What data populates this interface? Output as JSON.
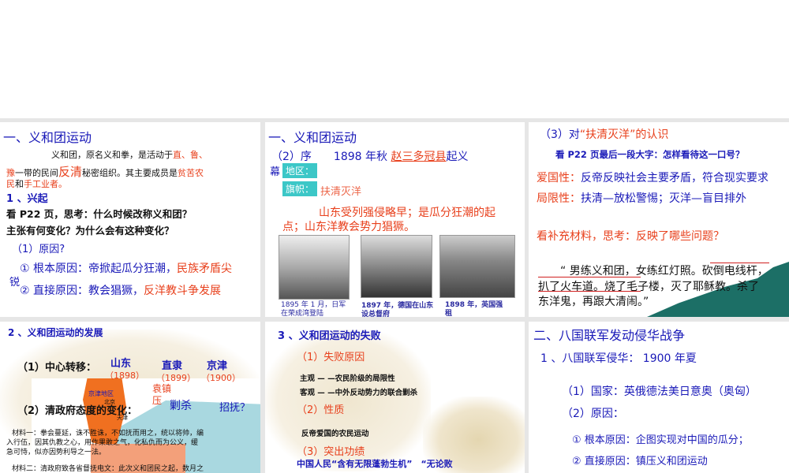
{
  "slides": [
    {
      "title": "一、义和团运动",
      "p1a": "义和团，原名义和拳，是活动于",
      "p1b": "直、鲁、",
      "p2a": "豫",
      "p2b": "一带的民间",
      "p2c": "反清",
      "p2d": "秘密组织。其主要成员是",
      "p2e": "贫苦农",
      "p3a": "民",
      "p3b": "和",
      "p3c": "手工业者。",
      "sub": "1 、兴起",
      "q1": "看 P22 页，思考：什么时候改称义和团？",
      "q2": "主张有何变化？为什么会有这种变化？",
      "reason": "（1）原因?",
      "r1a": "① 根本原因：帝掀起瓜分狂潮，",
      "r1b": "民族矛盾尖",
      "r1c": "锐",
      "r2a": "② 直接原因：教会猖獗，",
      "r2b": "反洋教斗争发展"
    },
    {
      "title": "一、义和团运动",
      "seq": "（2）序",
      "year": "1898 年秋",
      "place": "赵三多冠县",
      "rise": "起义",
      "mu": "幕",
      "area_label": "地区：",
      "flag_label": "旗帜：",
      "flag": "扶清灭洋",
      "reason1": "山东受列强侵略早；是瓜分狂潮的起",
      "reason2": "点；山东洋教会势力猖獗。",
      "captions": [
        "1895 年 1 月，日军在荣成湾登陆",
        "1897 年，德国在山东设总督府",
        "1898 年，英国强租"
      ]
    },
    {
      "title_a": "（3）对",
      "title_b": "“扶清灭洋”的认识",
      "look": "看 P22 页最后一段大字：怎样看待这一口号？",
      "pat_label": "爱国性：",
      "pat": "反帝反映社会主要矛盾，符合现实要求",
      "lim_label": "局限性：",
      "lim": "扶清—放松警惕；灭洋—盲目排外",
      "think": "看补充材料，思考：反映了哪些问题？",
      "quote1": "“ 男练义和团，女练红灯照。砍倒电线杆，",
      "quote2": "扒了火车道。烧了毛子楼，灭了耶稣教。杀了",
      "quote3": "东洋鬼，再跟大清闹。”"
    },
    {
      "title": "2 、义和团运动的发展",
      "c1": "（1）中心转移：",
      "places": [
        "山东",
        "直隶",
        "京津"
      ],
      "years": [
        "（1898）",
        "（1899）",
        "（1900）"
      ],
      "yuan": "袁镇压",
      "kill": "剿杀",
      "zhao": "招抚？",
      "c2": "（2）清政府态度的变化：",
      "map_label": "京津地区",
      "beijing": "北京",
      "tianjin": "天津",
      "m1": "材料一：拳会蔓延，诛不胜诛，不如抚而用之，统以将帅，编",
      "m2": "入行伍，因其仇教之心，用作果敢之气，化私仇而为公义，缓",
      "m3": "急可恃，似亦因势利导之一法。",
      "m4": "材料二：清政府致各省督抚电文：此次义和团民之起，数月之"
    },
    {
      "title": "3 、义和团运动的失败",
      "s1": "（1）失败原因",
      "sub1": "主观 — —农民阶级的局限性",
      "sub2": "客观 — —中外反动势力的联合剿杀",
      "s2": "（2）性质",
      "nature": "反帝爱国的农民运动",
      "s3": "（3）突出功绩",
      "merit": "中国人民“含有无限蓬勃生机”　“无论败"
    },
    {
      "title": "二、八国联军发动侵华战争",
      "s1": "1 、八国联军侵华： 1900 年夏",
      "countries": "（1）国家：英俄德法美日意奥（奥匈）",
      "reason": "（2）原因：",
      "r1": "① 根本原因：企图实现对中国的瓜分；",
      "r2": "② 直接原因：镇压义和团运动"
    }
  ]
}
